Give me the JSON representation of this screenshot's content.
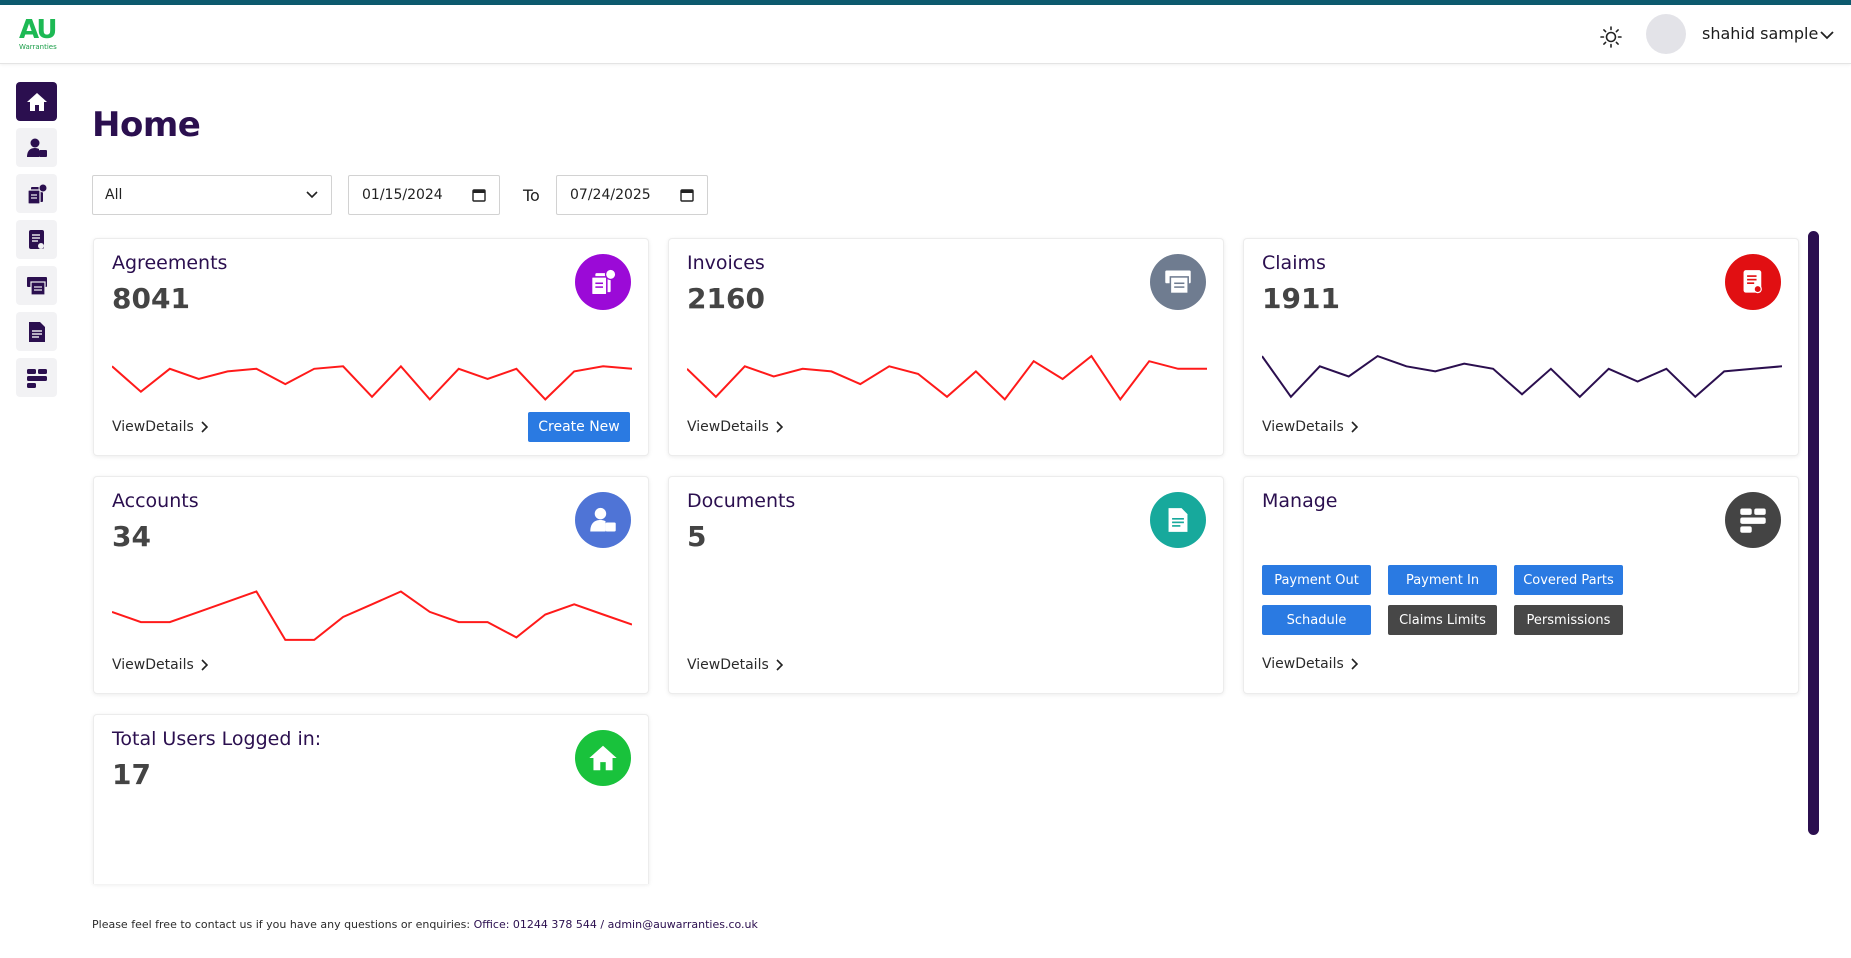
{
  "header": {
    "logo_text": "AU",
    "logo_subtext": "Warranties",
    "username": "shahid sample",
    "theme_icon": "sun-icon"
  },
  "sidebar": {
    "items": [
      {
        "name": "home",
        "icon": "home-icon",
        "active": true
      },
      {
        "name": "accounts",
        "icon": "user-briefcase-icon",
        "active": false
      },
      {
        "name": "agreements",
        "icon": "documents-check-icon",
        "active": false
      },
      {
        "name": "claims",
        "icon": "claim-doc-icon",
        "active": false
      },
      {
        "name": "invoices",
        "icon": "invoice-icon",
        "active": false
      },
      {
        "name": "documents",
        "icon": "document-icon",
        "active": false
      },
      {
        "name": "manage",
        "icon": "manage-blocks-icon",
        "active": false
      }
    ]
  },
  "page": {
    "title": "Home"
  },
  "filters": {
    "select_value": "All",
    "date_from": "01/15/2024",
    "to_label": "To",
    "date_to": "07/24/2025"
  },
  "cards": {
    "agreements": {
      "title": "Agreements",
      "value": "8041",
      "view": "ViewDetails",
      "create": "Create New",
      "icon_color": "#9b0ad7",
      "line_color": "#ff1a1a"
    },
    "invoices": {
      "title": "Invoices",
      "value": "2160",
      "view": "ViewDetails",
      "icon_color": "#6f7c90",
      "line_color": "#ff1a1a"
    },
    "claims": {
      "title": "Claims",
      "value": "1911",
      "view": "ViewDetails",
      "icon_color": "#e10f12",
      "line_color": "#2b0f4f"
    },
    "accounts": {
      "title": "Accounts",
      "value": "34",
      "view": "ViewDetails",
      "icon_color": "#4f74d6",
      "line_color": "#ff1a1a"
    },
    "documents": {
      "title": "Documents",
      "value": "5",
      "view": "ViewDetails",
      "icon_color": "#17a99c"
    },
    "manage": {
      "title": "Manage",
      "view": "ViewDetails",
      "icon_color": "#444444",
      "buttons": [
        {
          "label": "Payment Out",
          "color": "blue"
        },
        {
          "label": "Payment In",
          "color": "blue"
        },
        {
          "label": "Covered Parts",
          "color": "blue"
        },
        {
          "label": "Schadule",
          "color": "blue"
        },
        {
          "label": "Claims Limits",
          "color": "grey"
        },
        {
          "label": "Persmissions",
          "color": "grey"
        }
      ]
    },
    "users": {
      "title": "Total Users Logged in:",
      "value": "17",
      "icon_color": "#19c23c"
    }
  },
  "sparklines": {
    "agreements": [
      40,
      20,
      38,
      30,
      36,
      38,
      26,
      38,
      40,
      16,
      40,
      14,
      38,
      30,
      38,
      14,
      36,
      40,
      38
    ],
    "invoices": [
      38,
      16,
      40,
      32,
      38,
      36,
      26,
      40,
      34,
      16,
      36,
      14,
      44,
      30,
      48,
      14,
      44,
      38,
      38
    ],
    "claims": [
      48,
      16,
      40,
      32,
      48,
      40,
      36,
      42,
      38,
      18,
      38,
      16,
      38,
      28,
      38,
      16,
      36,
      38,
      40
    ],
    "accounts": [
      34,
      26,
      26,
      34,
      42,
      50,
      12,
      12,
      30,
      40,
      50,
      34,
      26,
      26,
      14,
      32,
      40,
      32,
      24
    ]
  },
  "footer": {
    "text": "Please feel free to contact us if you have any questions or enquiries: ",
    "link": "Office: 01244 378 544 / admin@auwarranties.co.uk"
  }
}
